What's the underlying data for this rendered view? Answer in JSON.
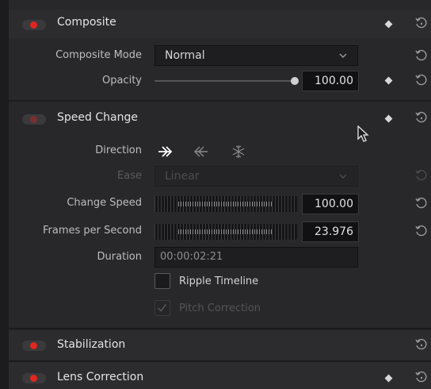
{
  "composite": {
    "title": "Composite",
    "mode_label": "Composite Mode",
    "mode_value": "Normal",
    "opacity_label": "Opacity",
    "opacity_value": "100.00"
  },
  "speed_change": {
    "title": "Speed Change",
    "direction_label": "Direction",
    "direction_icons": [
      "forward-icon",
      "reverse-icon",
      "freeze-icon"
    ],
    "ease_label": "Ease",
    "ease_value": "Linear",
    "change_speed_label": "Change Speed",
    "change_speed_value": "100.00",
    "fps_label": "Frames per Second",
    "fps_value": "23.976",
    "duration_label": "Duration",
    "duration_value": "00:00:02:21",
    "ripple_label": "Ripple Timeline",
    "pitch_label": "Pitch Correction"
  },
  "stabilization": {
    "title": "Stabilization"
  },
  "lens_correction": {
    "title": "Lens Correction"
  },
  "colors": {
    "toggle_on": "#e0261e",
    "background": "#28282b"
  }
}
